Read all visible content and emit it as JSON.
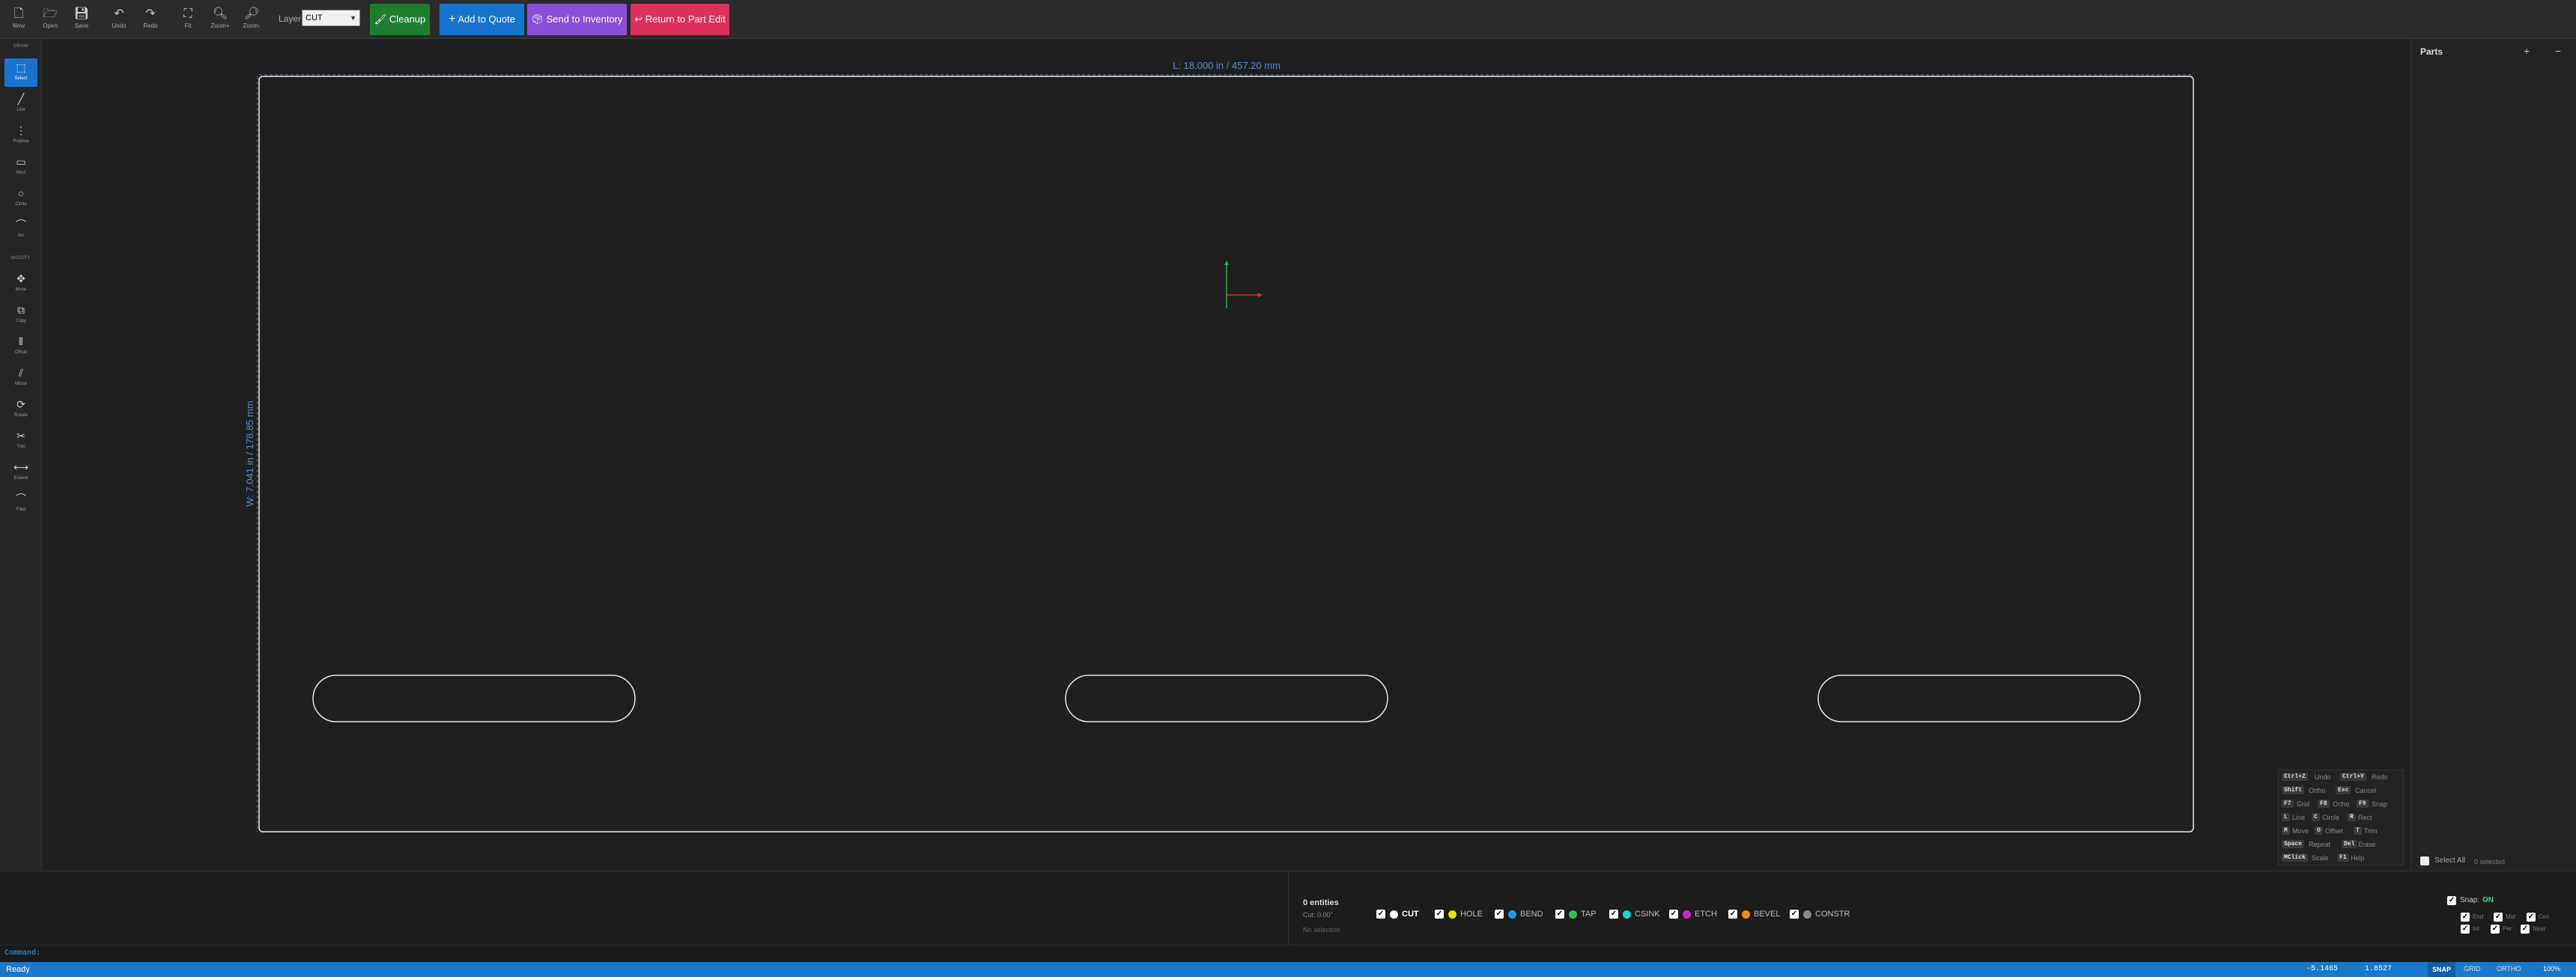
{
  "toolbar": {
    "new": "New",
    "open": "Open",
    "save": "Save",
    "undo": "Undo",
    "redo": "Redo",
    "fit": "Fit",
    "zoom_in": "Zoom+",
    "zoom_out": "Zoom-",
    "layer_label": "Layer:",
    "layer_value": "CUT",
    "cleanup": "Cleanup",
    "add_to_quote": "Add to Quote",
    "send_to_inventory": "Send to Inventory",
    "return_to_part_edit": "Return to Part Edit"
  },
  "sidebar": {
    "draw_section": "DRAW",
    "modify_section": "MODIFY",
    "draw_tools": [
      "Select",
      "Line",
      "Polyline",
      "Rect",
      "Circle",
      "Arc"
    ],
    "modify_tools": [
      "Move",
      "Copy",
      "Offset",
      "Mirror",
      "Rotate",
      "Trim",
      "Extend",
      "Fillet"
    ]
  },
  "canvas": {
    "dim_length": "L: 18.000 in / 457.20 mm",
    "dim_width": "W: 7.041 in / 178.85 mm"
  },
  "parts_panel": {
    "title": "Parts",
    "add": "+",
    "remove": "−",
    "select_all": "Select All",
    "selected_count": "0 selected"
  },
  "shortcuts": [
    {
      "key": "Ctrl+Z",
      "desc": "Undo",
      "key2": "Ctrl+Y",
      "desc2": "Redo"
    },
    {
      "key": "Shift",
      "desc": "Ortho",
      "key2": "Esc",
      "desc2": "Cancel"
    },
    {
      "key": "F7",
      "desc": "Grid",
      "key2": "F8",
      "desc2": "Ortho",
      "key3": "F9",
      "desc3": "Snap"
    },
    {
      "key": "L",
      "desc": "Line",
      "key2": "C",
      "desc2": "Circle",
      "key3": "R",
      "desc3": "Rect"
    },
    {
      "key": "M",
      "desc": "Move",
      "key2": "O",
      "desc2": "Offset",
      "key3": "T",
      "desc3": "Trim"
    },
    {
      "key": "Space",
      "desc": "Repeat",
      "key2": "Del",
      "desc2": "Erase"
    },
    {
      "key": "MClick",
      "desc": "Scale",
      "key2": "F1",
      "desc2": "Help"
    }
  ],
  "info": {
    "entities": "0 entities",
    "cut_length": "Cut: 0.00\"",
    "selection": "No selection"
  },
  "layers": [
    {
      "name": "CUT",
      "color": "#ffffff"
    },
    {
      "name": "HOLE",
      "color": "#f5d90a"
    },
    {
      "name": "BEND",
      "color": "#1e9bf0"
    },
    {
      "name": "TAP",
      "color": "#2fbf4f"
    },
    {
      "name": "CSINK",
      "color": "#1fd3d3"
    },
    {
      "name": "ETCH",
      "color": "#d41fd4"
    },
    {
      "name": "BEVEL",
      "color": "#f08a1e"
    },
    {
      "name": "CONSTR",
      "color": "#8a8a8a"
    }
  ],
  "snap": {
    "label": "Snap:",
    "state": "ON",
    "options": [
      "End",
      "Mid",
      "Cen",
      "Int",
      "Per",
      "Near"
    ]
  },
  "command": {
    "prompt": "Command:"
  },
  "status": {
    "text": "Ready",
    "x": "-5.1465",
    "y": "1.8527",
    "snap": "SNAP",
    "grid": "GRID",
    "ortho": "ORTHO",
    "zoom": "100%"
  }
}
